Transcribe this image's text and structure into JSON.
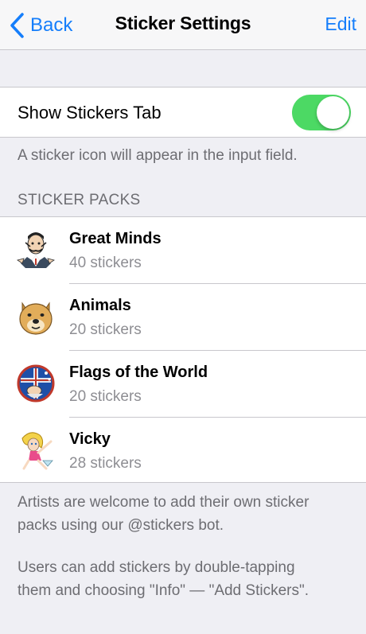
{
  "nav": {
    "back_label": "Back",
    "title": "Sticker Settings",
    "edit_label": "Edit"
  },
  "toggle": {
    "label": "Show Stickers Tab",
    "on": true,
    "footnote": "A sticker icon will appear in the input field."
  },
  "packs_header": "STICKER PACKS",
  "packs": [
    {
      "name": "Great Minds",
      "count": "40 stickers",
      "icon": "great-minds-sticker-icon"
    },
    {
      "name": "Animals",
      "count": "20 stickers",
      "icon": "doge-sticker-icon"
    },
    {
      "name": "Flags of the World",
      "count": "20 stickers",
      "icon": "flags-sticker-icon"
    },
    {
      "name": "Vicky",
      "count": "28 stickers",
      "icon": "vicky-sticker-icon"
    }
  ],
  "footer": {
    "line1": "Artists are welcome to add their own sticker",
    "line2": "packs using our @stickers bot.",
    "line3": "Users can add stickers by double-tapping",
    "line4": "them and choosing \"Info\" — \"Add Stickers\"."
  },
  "colors": {
    "accent": "#157efb",
    "switch_on": "#4cd964",
    "background": "#efeff4",
    "secondary_text": "#6d6d72"
  }
}
